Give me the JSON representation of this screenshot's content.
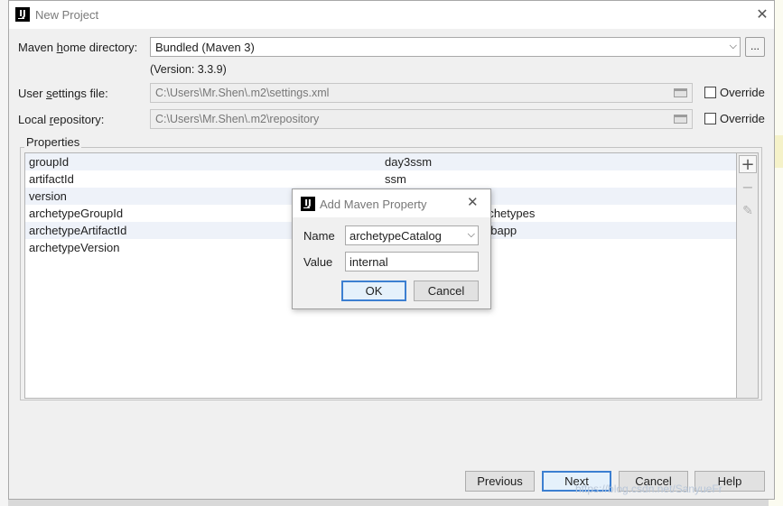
{
  "dialog": {
    "title": "New Project",
    "maven_home": {
      "label_pre": "Maven ",
      "label_mnemonic": "h",
      "label_post": "ome directory:",
      "value": "Bundled (Maven 3)",
      "browse": "...",
      "version": "(Version: 3.3.9)"
    },
    "user_settings": {
      "label_pre": "User ",
      "label_mnemonic": "s",
      "label_post": "ettings file:",
      "value": "C:\\Users\\Mr.Shen\\.m2\\settings.xml",
      "override": "Override"
    },
    "local_repo": {
      "label_pre": "Local ",
      "label_mnemonic": "r",
      "label_post": "epository:",
      "value": "C:\\Users\\Mr.Shen\\.m2\\repository",
      "override": "Override"
    },
    "properties": {
      "title": "Properties",
      "rows": [
        {
          "key": "groupId",
          "value": "day3ssm"
        },
        {
          "key": "artifactId",
          "value": "ssm"
        },
        {
          "key": "version",
          "value": ""
        },
        {
          "key": "archetypeGroupId",
          "value": "rchetypes"
        },
        {
          "key": "archetypeArtifactId",
          "value": "ebapp"
        },
        {
          "key": "archetypeVersion",
          "value": ""
        }
      ]
    },
    "buttons": {
      "previous": "Previous",
      "next": "Next",
      "cancel": "Cancel",
      "help": "Help"
    }
  },
  "popup": {
    "title": "Add Maven Property",
    "name_label": "Name",
    "name_value": "archetypeCatalog",
    "value_label": "Value",
    "value_value": "internal",
    "ok": "OK",
    "cancel": "Cancel"
  },
  "watermark": "https://blog.csdn.net/SanyueFr",
  "colors": {
    "accent": "#3c7fd1",
    "alt_row": "#eef2f9"
  }
}
